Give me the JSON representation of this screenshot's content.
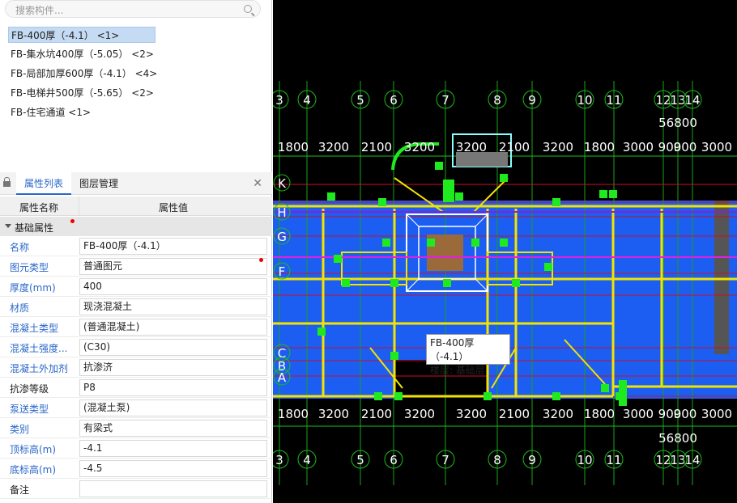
{
  "search": {
    "placeholder": "搜索构件..."
  },
  "components": [
    "FB-400厚（-4.1） <1>",
    "FB-集水坑400厚（-5.05） <2>",
    "FB-局部加厚600厚（-4.1） <4>",
    "FB-电梯井500厚（-5.65） <2>",
    "FB-住宅通道 <1>"
  ],
  "tabs": {
    "properties": "属性列表",
    "layers": "图层管理"
  },
  "header": {
    "name": "属性名称",
    "value": "属性值"
  },
  "group": {
    "label": "基础属性"
  },
  "properties": [
    {
      "key": "名称",
      "value": "FB-400厚（-4.1）",
      "blue": true
    },
    {
      "key": "图元类型",
      "value": "普通图元",
      "blue": true
    },
    {
      "key": "厚度(mm)",
      "value": "400",
      "blue": true
    },
    {
      "key": "材质",
      "value": "现浇混凝土",
      "blue": true
    },
    {
      "key": "混凝土类型",
      "value": "(普通混凝土)",
      "blue": true
    },
    {
      "key": "混凝土强度...",
      "value": "(C30)",
      "blue": true
    },
    {
      "key": "混凝土外加剂",
      "value": "抗渗济",
      "blue": true
    },
    {
      "key": "抗渗等级",
      "value": "P8",
      "blue": false
    },
    {
      "key": "泵送类型",
      "value": "(混凝土泵)",
      "blue": true
    },
    {
      "key": "类别",
      "value": "有梁式",
      "blue": true
    },
    {
      "key": "顶标高(m)",
      "value": "-4.1",
      "blue": true
    },
    {
      "key": "底标高(m)",
      "value": "-4.5",
      "blue": true
    },
    {
      "key": "备注",
      "value": "",
      "blue": false
    }
  ],
  "cad": {
    "axis_top": [
      "3",
      "4",
      "5",
      "6",
      "7",
      "8",
      "9",
      "10",
      "11",
      "12",
      "13",
      "14"
    ],
    "dims_top": [
      "1800",
      "3200",
      "2100",
      "3200",
      "3200",
      "2100",
      "3200",
      "1800",
      "3000",
      "900",
      "900",
      "3000"
    ],
    "total_dim": "56800",
    "dims_bottom": [
      "1800",
      "3200",
      "2100",
      "3200",
      "3200",
      "2100",
      "3200",
      "1800",
      "3000",
      "900",
      "900",
      "3000"
    ],
    "row_labels": [
      "K",
      "H",
      "G",
      "F",
      "C",
      "B",
      "A"
    ]
  },
  "tooltip": {
    "line1": "FB-400厚（-4.1）",
    "line2": "楼层: 基础层"
  }
}
